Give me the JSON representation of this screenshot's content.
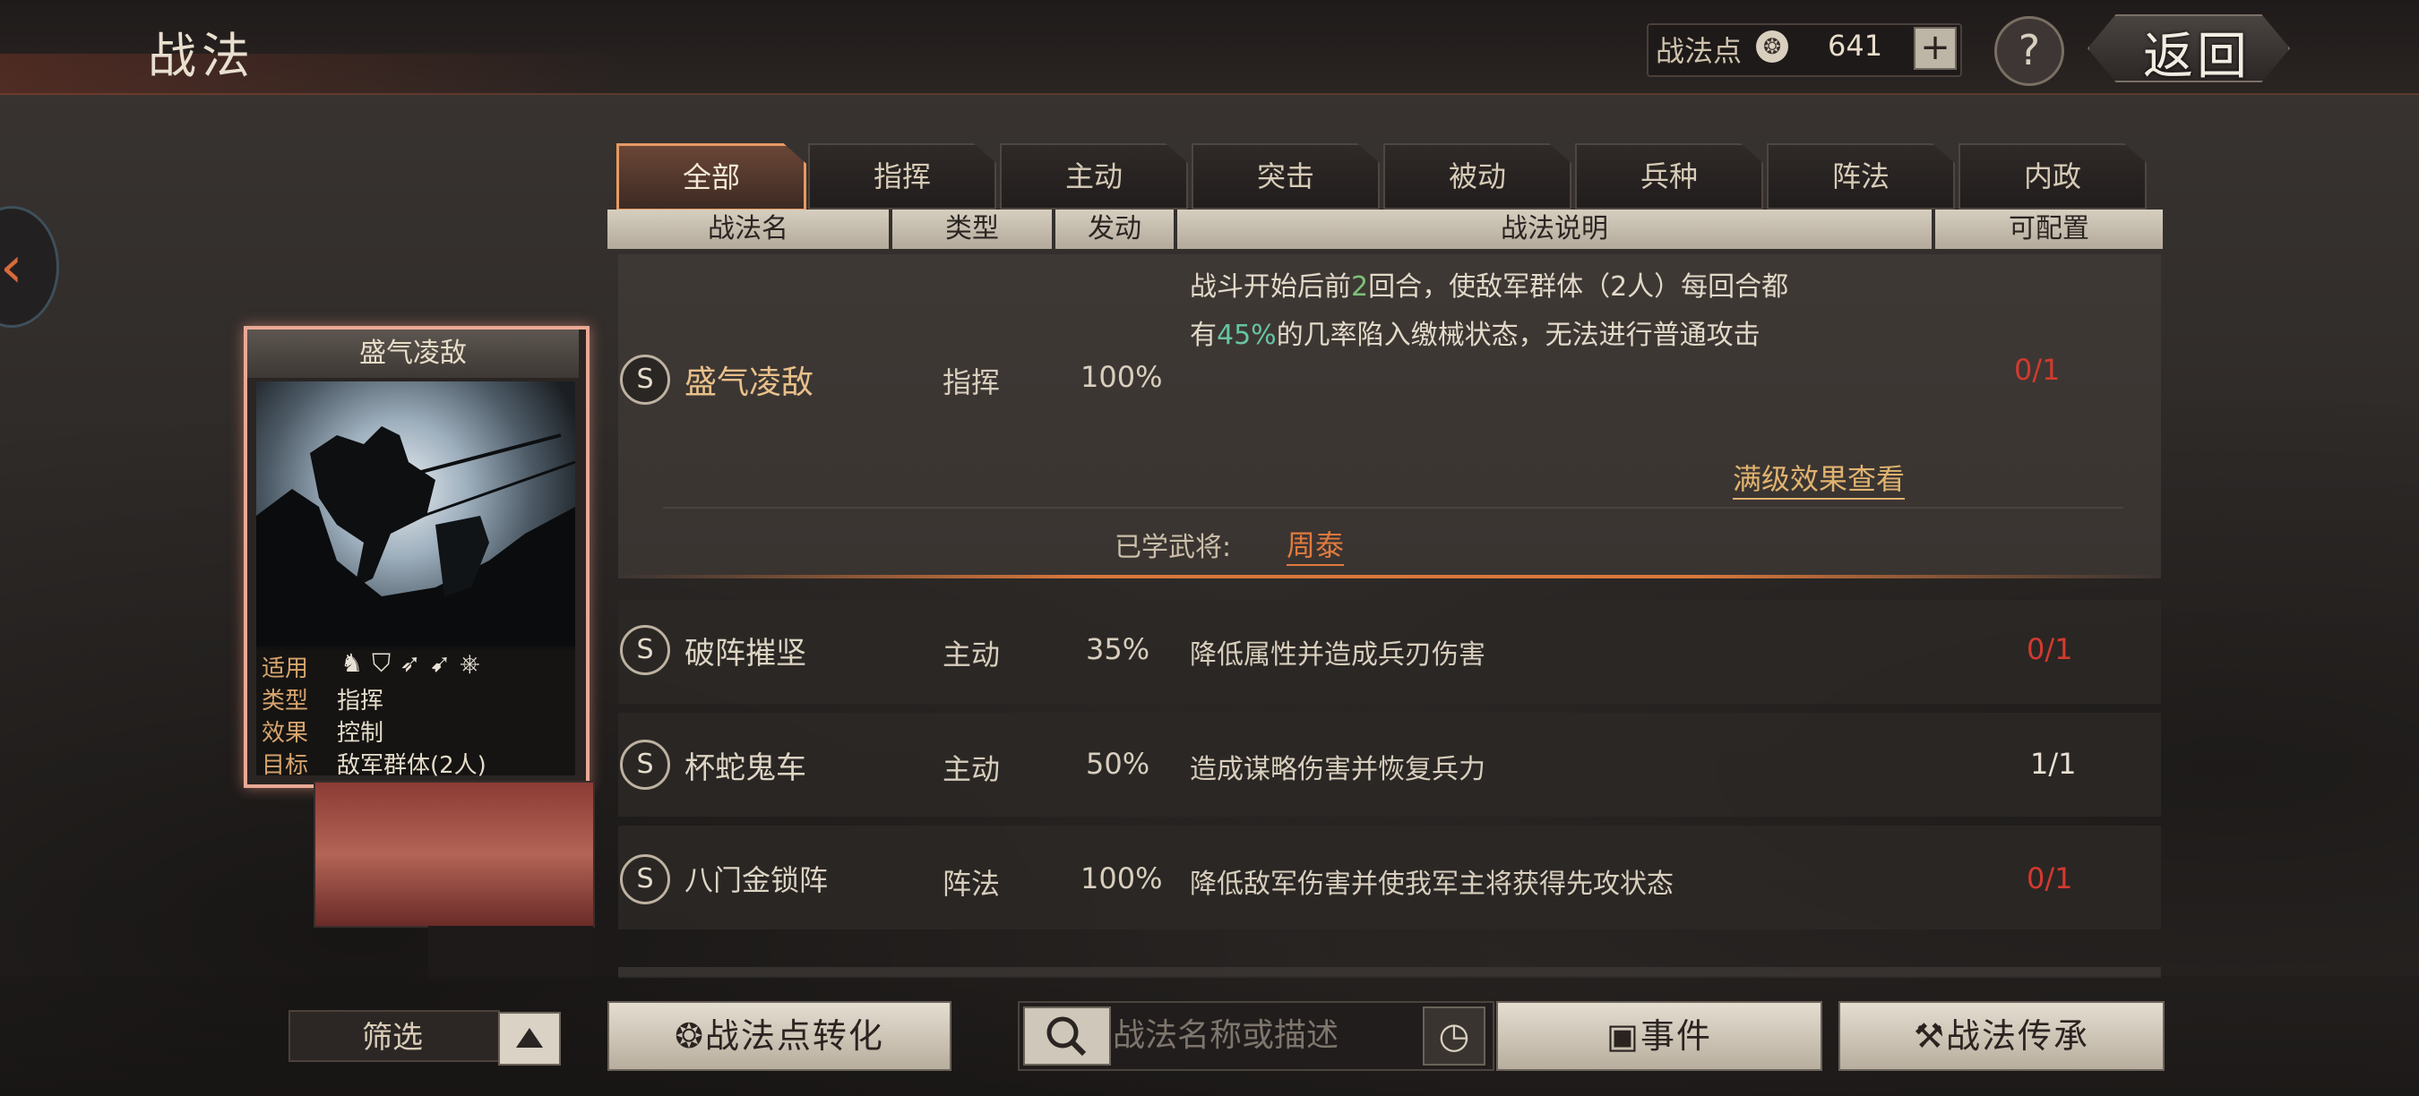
{
  "header": {
    "title": "战法",
    "points_label": "战法点",
    "points_value": "641",
    "plus": "+",
    "help": "?",
    "back": "返回"
  },
  "tabs": [
    "全部",
    "指挥",
    "主动",
    "突击",
    "被动",
    "兵种",
    "阵法",
    "内政"
  ],
  "columns": [
    "战法名",
    "类型",
    "发动",
    "战法说明",
    "可配置"
  ],
  "card": {
    "title": "盛气凌敌",
    "rows": [
      {
        "key": "适用",
        "val": ""
      },
      {
        "key": "类型",
        "val": "指挥"
      },
      {
        "key": "效果",
        "val": "控制"
      },
      {
        "key": "目标",
        "val": "敌军群体(2人)"
      }
    ]
  },
  "expanded": {
    "badge": "S",
    "name": "盛气凌敌",
    "type": "指挥",
    "rate": "100%",
    "desc_part1": "战斗开始后前",
    "desc_hl1": "2",
    "desc_part2": "回合，使敌军群体（2人）每回合都",
    "desc_part3": "有",
    "desc_hl2": "45%",
    "desc_part4": "的几率陷入缴械状态，无法进行普通攻击",
    "count": "0/1",
    "max_link": "满级效果查看",
    "learned_label": "已学武将:",
    "learned_general": "周泰"
  },
  "rows": [
    {
      "badge": "S",
      "name": "破阵摧坚",
      "type": "主动",
      "rate": "35%",
      "desc": "降低属性并造成兵刃伤害",
      "count": "0/1"
    },
    {
      "badge": "S",
      "name": "杯蛇鬼车",
      "type": "主动",
      "rate": "50%",
      "desc": "造成谋略伤害并恢复兵力",
      "count": "1/1"
    },
    {
      "badge": "S",
      "name": "八门金锁阵",
      "type": "阵法",
      "rate": "100%",
      "desc": "降低敌军伤害并使我军主将获得先攻状态",
      "count": "0/1"
    }
  ],
  "bottom": {
    "filter": "筛选",
    "convert": "战法点转化",
    "search_placeholder": "战法名称或描述",
    "event": "事件",
    "inherit": "战法传承"
  },
  "colors": {
    "accent": "#e79a62",
    "red_count": "#d23a2f",
    "gold": "#e8c08a"
  }
}
